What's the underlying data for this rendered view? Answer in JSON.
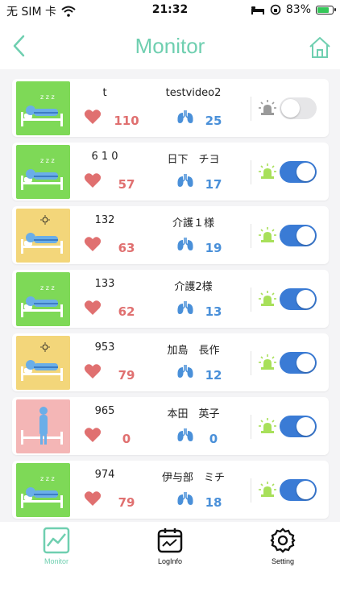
{
  "status_bar": {
    "carrier": "无 SIM 卡",
    "time": "21:32",
    "battery": "83%",
    "battery_level": 0.83
  },
  "header": {
    "title": "Monitor"
  },
  "colors": {
    "accent": "#6fcfb0",
    "heart": "#e07070",
    "lung": "#4a90d9",
    "toggle_on": "#3a7bd5",
    "sleep_bg": "#7ed957",
    "awake_bg": "#f3d67a",
    "away_bg": "#f4b6b6",
    "alarm_active": "#a8e05a",
    "alarm_inactive": "#9a9a9a"
  },
  "residents": [
    {
      "room": "t",
      "name": "testvideo2",
      "heart_rate": "110",
      "respiration": "25",
      "state": "sleep",
      "alarm_on": false
    },
    {
      "room": "6 1 0",
      "name": "日下　チヨ",
      "heart_rate": "57",
      "respiration": "17",
      "state": "sleep",
      "alarm_on": true
    },
    {
      "room": "132",
      "name": "介護１様",
      "heart_rate": "63",
      "respiration": "19",
      "state": "awake",
      "alarm_on": true
    },
    {
      "room": "133",
      "name": "介護2様",
      "heart_rate": "62",
      "respiration": "13",
      "state": "sleep",
      "alarm_on": true
    },
    {
      "room": "953",
      "name": "加島　長作",
      "heart_rate": "79",
      "respiration": "12",
      "state": "awake",
      "alarm_on": true
    },
    {
      "room": "965",
      "name": "本田　英子",
      "heart_rate": "0",
      "respiration": "0",
      "state": "away",
      "alarm_on": true
    },
    {
      "room": "974",
      "name": "伊与部　ミチ",
      "heart_rate": "79",
      "respiration": "18",
      "state": "sleep",
      "alarm_on": true
    }
  ],
  "tabs": [
    {
      "label": "Monitor",
      "icon": "chart-icon",
      "active": true
    },
    {
      "label": "LogInfo",
      "icon": "calendar-icon",
      "active": false
    },
    {
      "label": "Setting",
      "icon": "gear-icon",
      "active": false
    }
  ]
}
